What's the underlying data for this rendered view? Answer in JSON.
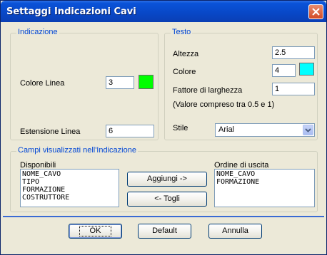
{
  "window": {
    "title": "Settaggi Indicazioni Cavi"
  },
  "indicazione": {
    "legend": "Indicazione",
    "colore_linea_label": "Colore Linea",
    "colore_linea_value": "3",
    "colore_linea_swatch": "#00ff00",
    "estensione_linea_label": "Estensione Linea",
    "estensione_linea_value": "6"
  },
  "testo": {
    "legend": "Testo",
    "altezza_label": "Altezza",
    "altezza_value": "2.5",
    "colore_label": "Colore",
    "colore_value": "4",
    "colore_swatch": "#00ffff",
    "fattore_label": "Fattore di larghezza",
    "fattore_value": "1",
    "fattore_hint": "(Valore compreso tra 0.5 e 1)",
    "stile_label": "Stile",
    "stile_value": "Arial"
  },
  "campi": {
    "legend": "Campi visualizzati nell'Indicazione",
    "disponibili_label": "Disponibili",
    "disponibili_items": [
      "NOME_CAVO",
      "TIPO",
      "FORMAZIONE",
      "COSTRUTTORE"
    ],
    "ordine_label": "Ordine di uscita",
    "ordine_items": [
      "NOME_CAVO",
      "FORMAZIONE"
    ],
    "aggiungi_label": "Aggiungi ->",
    "togli_label": "<- Togli"
  },
  "footer": {
    "ok_label": "OK",
    "default_label": "Default",
    "annulla_label": "Annulla"
  },
  "colors": {
    "titlebar": "#0a53d8",
    "legend_text": "#0046d5",
    "separator": "#3a6bd4"
  }
}
